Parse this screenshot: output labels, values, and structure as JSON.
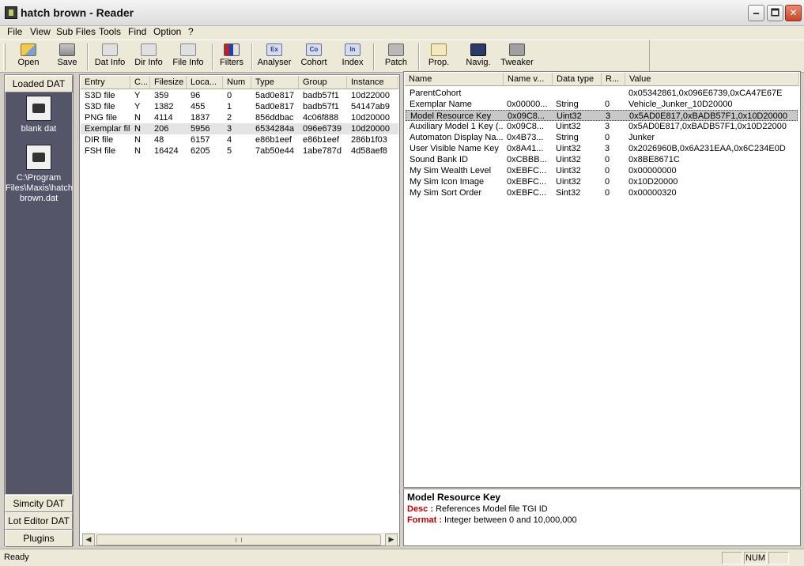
{
  "window": {
    "title": "hatch brown - Reader",
    "minimize_glyph": "🗕",
    "maximize_glyph": "🗖",
    "close_glyph": "✕"
  },
  "menu": [
    {
      "label": "File"
    },
    {
      "label": "View"
    },
    {
      "label": "Sub Files"
    },
    {
      "label": "Tools"
    },
    {
      "label": "Find"
    },
    {
      "label": "Option"
    },
    {
      "label": "?"
    }
  ],
  "toolbar": {
    "open": "Open",
    "save": "Save",
    "dat_info": "Dat Info",
    "dir_info": "Dir Info",
    "file_info": "File Info",
    "filters": "Filters",
    "analyser": "Analyser",
    "cohort": "Cohort",
    "index": "Index",
    "patch": "Patch",
    "prop": "Prop.",
    "navig": "Navig.",
    "tweaker": "Tweaker",
    "analyser_icon_text": "Ex",
    "cohort_icon_text": "Co",
    "index_icon_text": "In"
  },
  "sidebar": {
    "loaded_tab": "Loaded DAT",
    "dat_files": [
      {
        "label": "blank dat"
      },
      {
        "label": "C:\\Program Files\\Maxis\\hatch brown.dat"
      }
    ],
    "simcity_tab": "Simcity DAT",
    "lot_editor_tab": "Lot Editor DAT",
    "plugins_tab": "Plugins"
  },
  "entries": {
    "columns": [
      "Entry",
      "C...",
      "Filesize",
      "Loca...",
      "Num",
      "Type",
      "Group",
      "Instance"
    ],
    "rows": [
      {
        "entry": "S3D file",
        "c": "Y",
        "filesize": "359",
        "location": "96",
        "num": "0",
        "type": "5ad0e817",
        "group": "badb57f1",
        "instance": "10d22000"
      },
      {
        "entry": "S3D file",
        "c": "Y",
        "filesize": "1382",
        "location": "455",
        "num": "1",
        "type": "5ad0e817",
        "group": "badb57f1",
        "instance": "54147ab9"
      },
      {
        "entry": "PNG file",
        "c": "N",
        "filesize": "4114",
        "location": "1837",
        "num": "2",
        "type": "856ddbac",
        "group": "4c06f888",
        "instance": "10d20000"
      },
      {
        "entry": "Exemplar file",
        "c": "N",
        "filesize": "206",
        "location": "5956",
        "num": "3",
        "type": "6534284a",
        "group": "096e6739",
        "instance": "10d20000"
      },
      {
        "entry": "DIR file",
        "c": "N",
        "filesize": "48",
        "location": "6157",
        "num": "4",
        "type": "e86b1eef",
        "group": "e86b1eef",
        "instance": "286b1f03"
      },
      {
        "entry": "FSH file",
        "c": "N",
        "filesize": "16424",
        "location": "6205",
        "num": "5",
        "type": "7ab50e44",
        "group": "1abe787d",
        "instance": "4d58aef8"
      }
    ],
    "selected_row": 3,
    "scroll_left": "◀",
    "scroll_right": "▶"
  },
  "properties": {
    "columns": [
      "Name",
      "Name v...",
      "Data type",
      "R...",
      "Value"
    ],
    "rows": [
      {
        "name": "ParentCohort",
        "name_value": "",
        "data_type": "",
        "reps": "",
        "value": "0x05342861,0x096E6739,0xCA47E67E"
      },
      {
        "name": "Exemplar Name",
        "name_value": "0x00000...",
        "data_type": "String",
        "reps": "0",
        "value": "Vehicle_Junker_10D20000"
      },
      {
        "name": "Model Resource Key",
        "name_value": "0x09C8...",
        "data_type": "Uint32",
        "reps": "3",
        "value": "0x5AD0E817,0xBADB57F1,0x10D20000"
      },
      {
        "name": "Auxiliary Model 1 Key (...",
        "name_value": "0x09C8...",
        "data_type": "Uint32",
        "reps": "3",
        "value": "0x5AD0E817,0xBADB57F1,0x10D22000"
      },
      {
        "name": "Automaton Display Na...",
        "name_value": "0x4B73...",
        "data_type": "String",
        "reps": "0",
        "value": "Junker"
      },
      {
        "name": "User Visible Name Key",
        "name_value": "0x8A41...",
        "data_type": "Uint32",
        "reps": "3",
        "value": "0x2026960B,0x6A231EAA,0x6C234E0D"
      },
      {
        "name": "Sound Bank ID",
        "name_value": "0xCBBB...",
        "data_type": "Uint32",
        "reps": "0",
        "value": "0x8BE8671C"
      },
      {
        "name": "My Sim Wealth Level",
        "name_value": "0xEBFC...",
        "data_type": "Uint32",
        "reps": "0",
        "value": "0x00000000"
      },
      {
        "name": "My Sim Icon Image",
        "name_value": "0xEBFC...",
        "data_type": "Uint32",
        "reps": "0",
        "value": "0x10D20000"
      },
      {
        "name": "My Sim Sort Order",
        "name_value": "0xEBFC...",
        "data_type": "Sint32",
        "reps": "0",
        "value": "0x00000320"
      }
    ],
    "selected_row": 2
  },
  "description": {
    "title": "Model Resource Key",
    "desc_label": "Desc :",
    "desc_text": " References Model file TGI ID",
    "format_label": "Format :",
    "format_text": " Integer between 0 and 10,000,000"
  },
  "status": {
    "text": "Ready",
    "num": "NUM"
  }
}
